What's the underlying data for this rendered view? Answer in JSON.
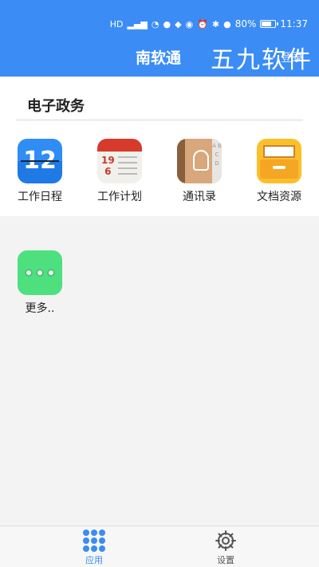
{
  "status_bar": {
    "battery": "80%",
    "battery_level": 0.8,
    "time": "11:37",
    "icons": [
      "hd-icon",
      "signal-icon",
      "wifi-icon",
      "message-icon",
      "app-notification-icon",
      "eye-icon",
      "alarm-icon",
      "bluetooth-icon",
      "location-icon",
      "battery-icon"
    ]
  },
  "header": {
    "title": "南软通",
    "login": "登录",
    "watermark": "五九软件"
  },
  "section": {
    "title": "电子政务",
    "apps": [
      {
        "label": "工作日程",
        "icon": "calendar-icon",
        "icon_text": "12"
      },
      {
        "label": "工作计划",
        "icon": "plan-icon",
        "date_top": "19",
        "date_bottom": "6"
      },
      {
        "label": "通讯录",
        "icon": "contacts-icon",
        "tab_letters": "A B C D"
      },
      {
        "label": "文档资源",
        "icon": "documents-icon"
      }
    ]
  },
  "more": {
    "label": "更多..",
    "icon": "more-icon"
  },
  "bottom_nav": {
    "apps": {
      "label": "应用",
      "icon": "grid-icon",
      "active_color": "#3b8cf5"
    },
    "settings": {
      "label": "设置",
      "icon": "gear-icon"
    }
  },
  "colors": {
    "primary": "#3b8cf5",
    "more_green": "#4ee07f"
  }
}
